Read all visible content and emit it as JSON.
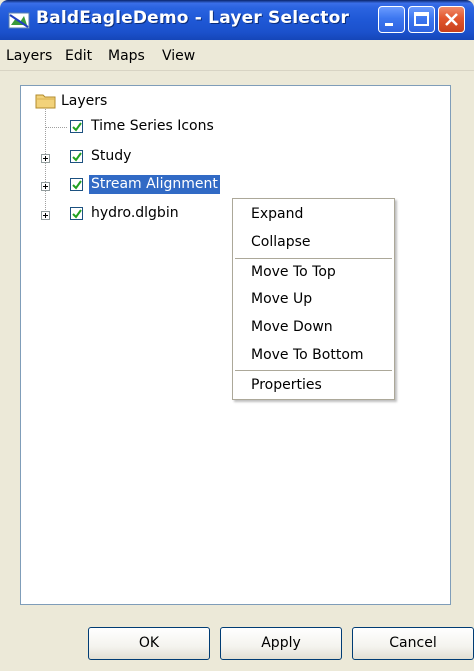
{
  "window": {
    "title": "BaldEagleDemo - Layer Selector",
    "buttons": [
      "minimize-icon",
      "maximize-icon",
      "close-icon"
    ]
  },
  "menubar": {
    "items": [
      "Layers",
      "Edit",
      "Maps",
      "View"
    ]
  },
  "tree": {
    "root": {
      "label": "Layers",
      "icon": "folder-icon"
    },
    "nodes": [
      {
        "label": "Time Series Icons",
        "checked": true,
        "expandable": false,
        "selected": false
      },
      {
        "label": "Study",
        "checked": true,
        "expandable": true,
        "selected": false
      },
      {
        "label": "Stream Alignment",
        "checked": true,
        "expandable": true,
        "selected": true
      },
      {
        "label": "hydro.dlgbin",
        "checked": true,
        "expandable": true,
        "selected": false
      }
    ]
  },
  "context_menu": {
    "groups": [
      [
        "Expand",
        "Collapse"
      ],
      [
        "Move To Top",
        "Move Up",
        "Move Down",
        "Move To Bottom"
      ],
      [
        "Properties"
      ]
    ]
  },
  "buttons": {
    "ok": "OK",
    "apply": "Apply",
    "cancel": "Cancel"
  },
  "colors": {
    "titlebar": "#2a63e0",
    "selection": "#316ac5",
    "dialog_bg": "#ece9d8"
  }
}
